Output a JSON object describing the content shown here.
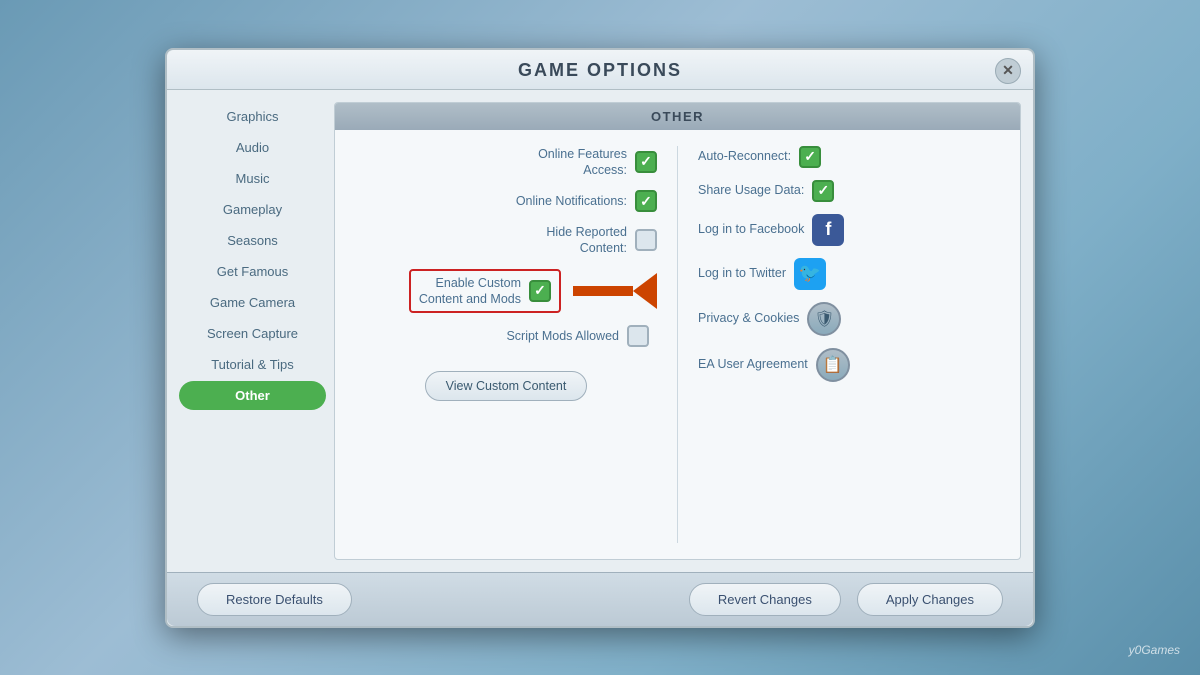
{
  "dialog": {
    "title": "Game Options",
    "close_label": "✕"
  },
  "sidebar": {
    "items": [
      {
        "id": "graphics",
        "label": "Graphics",
        "active": false
      },
      {
        "id": "audio",
        "label": "Audio",
        "active": false
      },
      {
        "id": "music",
        "label": "Music",
        "active": false
      },
      {
        "id": "gameplay",
        "label": "Gameplay",
        "active": false
      },
      {
        "id": "seasons",
        "label": "Seasons",
        "active": false
      },
      {
        "id": "get-famous",
        "label": "Get Famous",
        "active": false
      },
      {
        "id": "game-camera",
        "label": "Game Camera",
        "active": false
      },
      {
        "id": "screen-capture",
        "label": "Screen Capture",
        "active": false
      },
      {
        "id": "tutorial",
        "label": "Tutorial & Tips",
        "active": false
      },
      {
        "id": "other",
        "label": "Other",
        "active": true
      }
    ]
  },
  "section": {
    "header": "Other"
  },
  "settings": {
    "left": [
      {
        "id": "online-features",
        "label": "Online Features\nAccess:",
        "checked": true
      },
      {
        "id": "online-notifications",
        "label": "Online Notifications:",
        "checked": true
      },
      {
        "id": "hide-reported",
        "label": "Hide Reported\nContent:",
        "checked": false
      },
      {
        "id": "enable-custom",
        "label": "Enable Custom\nContent and Mods",
        "checked": true,
        "highlighted": true
      },
      {
        "id": "script-mods",
        "label": "Script Mods Allowed",
        "checked": false
      }
    ],
    "right": [
      {
        "id": "auto-reconnect",
        "label": "Auto-Reconnect:",
        "checked": true,
        "type": "checkbox"
      },
      {
        "id": "share-usage",
        "label": "Share Usage Data:",
        "checked": true,
        "type": "checkbox"
      },
      {
        "id": "facebook",
        "label": "Log in to Facebook",
        "type": "facebook"
      },
      {
        "id": "twitter",
        "label": "Log in to Twitter",
        "type": "twitter"
      },
      {
        "id": "privacy",
        "label": "Privacy & Cookies",
        "type": "shield"
      },
      {
        "id": "ea-agreement",
        "label": "EA User Agreement",
        "type": "document"
      }
    ]
  },
  "buttons": {
    "view_custom_content": "View Custom Content",
    "restore_defaults": "Restore Defaults",
    "revert_changes": "Revert Changes",
    "apply_changes": "Apply Changes"
  },
  "watermark": "y0Games"
}
